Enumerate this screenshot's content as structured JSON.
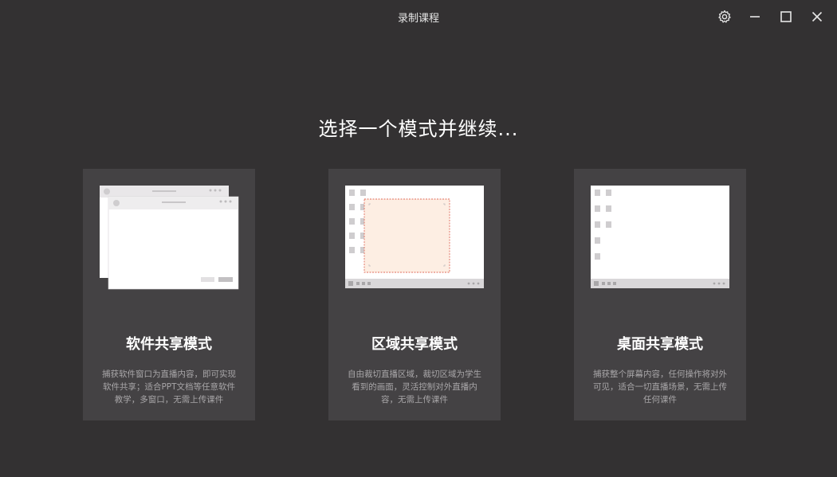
{
  "window": {
    "title": "录制课程",
    "controls": [
      "settings-icon",
      "minimize-icon",
      "maximize-icon",
      "close-icon"
    ]
  },
  "heading": "选择一个模式并继续...",
  "cards": [
    {
      "title": "软件共享模式",
      "description": "捕获软件窗口为直播内容，即可实现软件共享；适合PPT文档等任意软件教学，多窗口，无需上传课件"
    },
    {
      "title": "区域共享模式",
      "description": "自由裁切直播区域，裁切区域为学生看到的画面，灵活控制对外直播内容，无需上传课件"
    },
    {
      "title": "桌面共享模式",
      "description": "捕获整个屏幕内容，任何操作将对外可见，适合一切直播场景，无需上传任何课件"
    }
  ],
  "colors": {
    "background": "#333132",
    "card": "#444244",
    "crop_region": "#fdeee3",
    "crop_border": "#e06b5a"
  }
}
